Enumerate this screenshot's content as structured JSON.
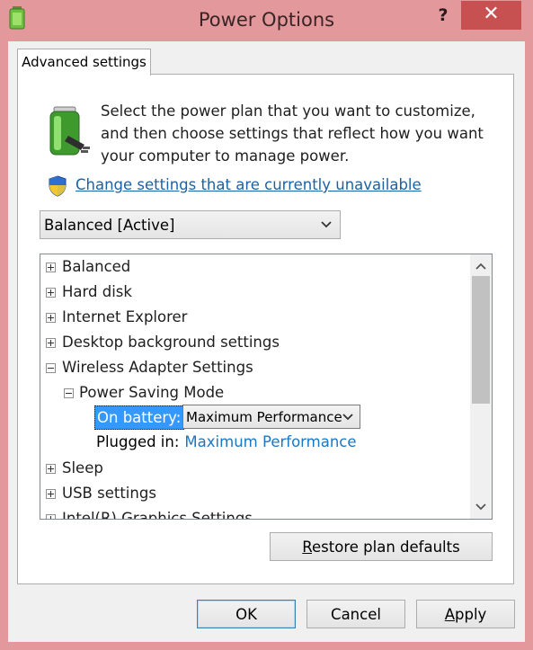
{
  "window": {
    "title": "Power Options",
    "help_label": "?",
    "close_label": "✕",
    "app_icon": "battery-app-icon"
  },
  "tab": {
    "label": "Advanced settings"
  },
  "intro": {
    "description": "Select the power plan that you want to customize, and then choose settings that reflect how you want your computer to manage power.",
    "change_link": "Change settings that are currently unavailable",
    "icons": [
      "battery-plug-icon",
      "uac-shield-icon"
    ]
  },
  "plan_select": {
    "value": "Balanced [Active]"
  },
  "tree": {
    "items": [
      {
        "label": "Balanced",
        "state": "collapsed"
      },
      {
        "label": "Hard disk",
        "state": "collapsed"
      },
      {
        "label": "Internet Explorer",
        "state": "collapsed"
      },
      {
        "label": "Desktop background settings",
        "state": "collapsed"
      },
      {
        "label": "Wireless Adapter Settings",
        "state": "expanded"
      },
      {
        "label": "Power Saving Mode",
        "state": "expanded"
      },
      {
        "label": "Sleep",
        "state": "collapsed"
      },
      {
        "label": "USB settings",
        "state": "collapsed"
      },
      {
        "label": "Intel(R) Graphics Settings",
        "state": "collapsed"
      }
    ],
    "on_battery": {
      "label": "On battery:",
      "value": "Maximum Performance"
    },
    "plugged_in": {
      "label": "Plugged in:",
      "value": "Maximum Performance"
    }
  },
  "buttons": {
    "restore_prefix": "R",
    "restore_rest": "estore plan defaults",
    "ok": "OK",
    "cancel": "Cancel",
    "apply_prefix": "A",
    "apply_rest": "pply"
  },
  "colors": {
    "frame": "#e3989c",
    "close": "#c75050",
    "link": "#1a62a8",
    "selection": "#3399ff"
  }
}
